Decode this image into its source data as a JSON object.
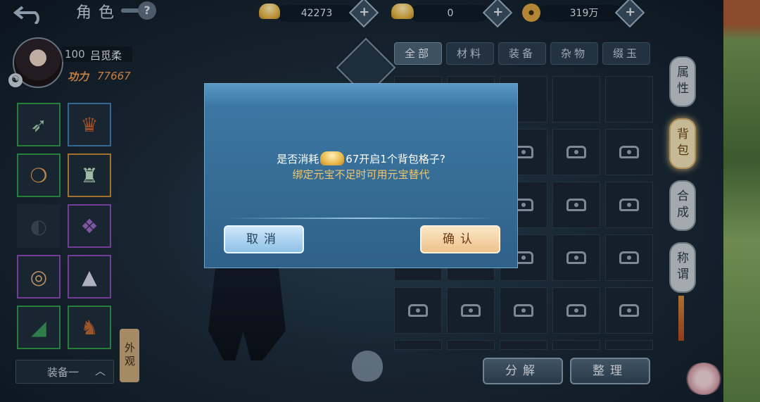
{
  "header": {
    "title": "角色"
  },
  "currencies": [
    {
      "icon": "gold-ingot-icon",
      "value": "42273"
    },
    {
      "icon": "bound-ingot-icon",
      "value": "0"
    },
    {
      "icon": "coin-icon",
      "value": "319万"
    }
  ],
  "player": {
    "level": "100",
    "name": "吕觅柔",
    "power_label": "功力",
    "power_value": "77667"
  },
  "equipment": {
    "slots": [
      {
        "icon": "arrows-icon",
        "quality": "green"
      },
      {
        "icon": "helmet-icon",
        "quality": "blue"
      },
      {
        "icon": "necklace-icon",
        "quality": "green"
      },
      {
        "icon": "robe-icon",
        "quality": "orange"
      },
      {
        "icon": "empty-ring-icon",
        "quality": "none"
      },
      {
        "icon": "belt-icon",
        "quality": "purple"
      },
      {
        "icon": "bracelet-icon",
        "quality": "purple"
      },
      {
        "icon": "skirt-icon",
        "quality": "purple"
      },
      {
        "icon": "bracers-icon",
        "quality": "green"
      },
      {
        "icon": "boots-icon",
        "quality": "green"
      }
    ],
    "set_label": "装备一",
    "appearance_label": "外观"
  },
  "inventory": {
    "tabs": [
      "全部",
      "材料",
      "装备",
      "杂物",
      "缀玉"
    ],
    "active_tab": 0
  },
  "side_menu": [
    "属性",
    "背包",
    "合成",
    "称谓"
  ],
  "side_active": 1,
  "bottom_buttons": {
    "decompose": "分解",
    "sort": "整理"
  },
  "dialog": {
    "line1_prefix": "是否消耗",
    "line1_amount": "67",
    "line1_suffix": "开启1个背包格子?",
    "line2": "绑定元宝不足时可用元宝替代",
    "cancel_label": "取消",
    "confirm_label": "确认"
  }
}
